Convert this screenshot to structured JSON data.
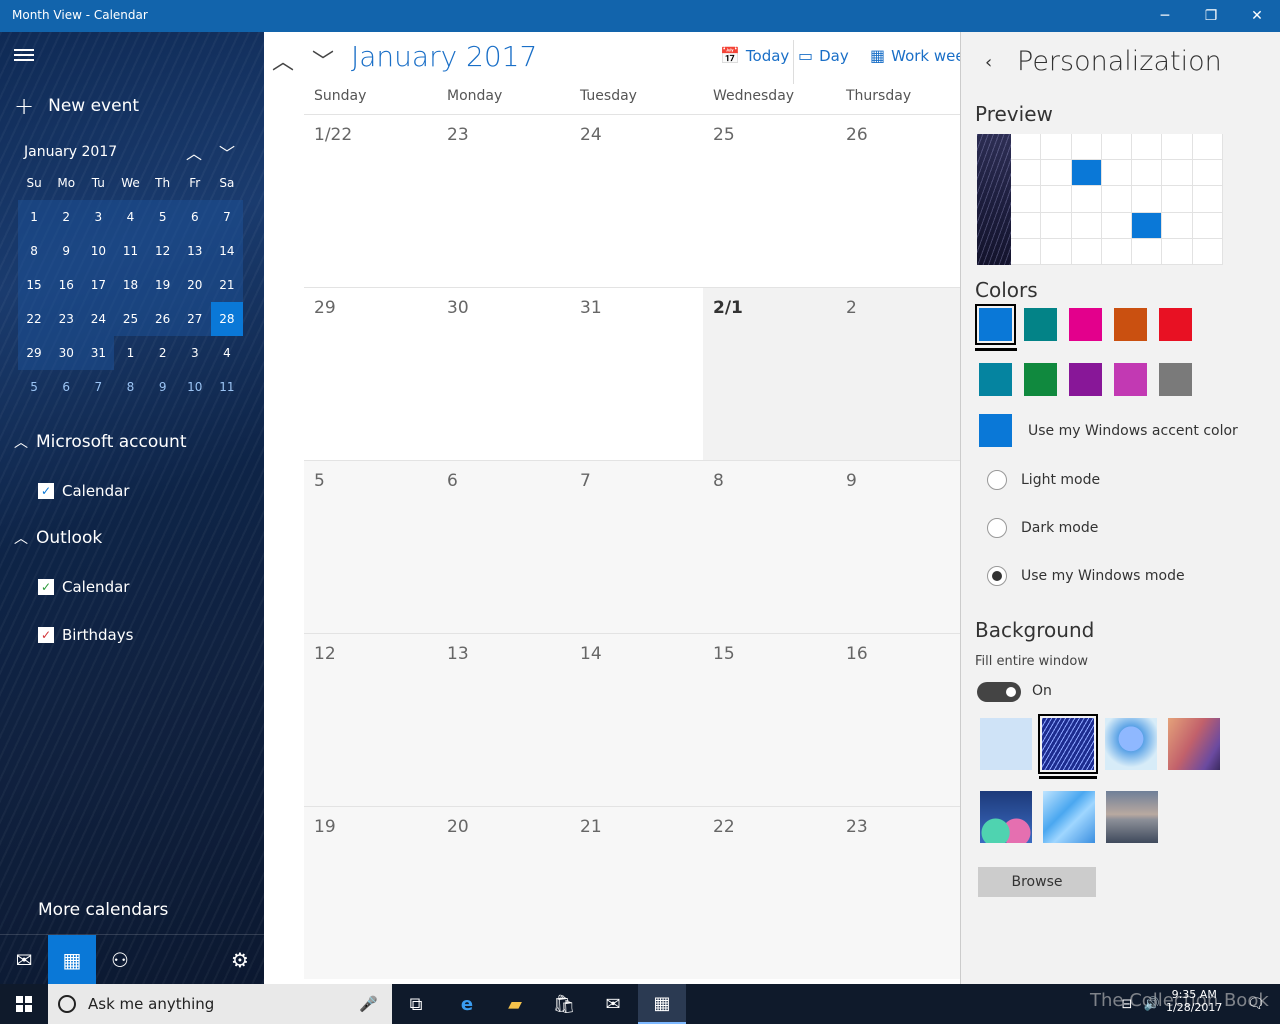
{
  "window": {
    "title": "Month View - Calendar",
    "minimize_icon": "─",
    "restore_icon": "❐",
    "close_icon": "✕"
  },
  "sidebar": {
    "new_event": "New event",
    "mini_calendar": {
      "month_label": "January 2017",
      "days_of_week": [
        "Su",
        "Mo",
        "Tu",
        "We",
        "Th",
        "Fr",
        "Sa"
      ],
      "days": [
        [
          "1",
          "2",
          "3",
          "4",
          "5",
          "6",
          "7"
        ],
        [
          "8",
          "9",
          "10",
          "11",
          "12",
          "13",
          "14"
        ],
        [
          "15",
          "16",
          "17",
          "18",
          "19",
          "20",
          "21"
        ],
        [
          "22",
          "23",
          "24",
          "25",
          "26",
          "27",
          "28"
        ],
        [
          "29",
          "30",
          "31",
          "1",
          "2",
          "3",
          "4"
        ],
        [
          "5",
          "6",
          "7",
          "8",
          "9",
          "10",
          "11"
        ]
      ],
      "selected_day": "28"
    },
    "accounts": [
      {
        "name": "Microsoft account",
        "calendars": [
          {
            "label": "Calendar",
            "color": "#0a78d7"
          }
        ]
      },
      {
        "name": "Outlook",
        "calendars": [
          {
            "label": "Calendar",
            "color": "#2b9a3a"
          },
          {
            "label": "Birthdays",
            "color": "#d13438"
          }
        ]
      }
    ],
    "more_calendars": "More calendars",
    "bottom_icons": [
      "mail-icon",
      "calendar-icon",
      "people-icon",
      "settings-icon"
    ]
  },
  "main": {
    "month_title": "January 2017",
    "toolbar": {
      "today": "Today",
      "day": "Day",
      "work_week": "Work week"
    },
    "days_of_week": [
      "Sunday",
      "Monday",
      "Tuesday",
      "Wednesday",
      "Thursday"
    ],
    "weeks": [
      [
        "1/22",
        "23",
        "24",
        "25",
        "26"
      ],
      [
        "29",
        "30",
        "31",
        "2/1",
        "2"
      ],
      [
        "5",
        "6",
        "7",
        "8",
        "9"
      ],
      [
        "12",
        "13",
        "14",
        "15",
        "16"
      ],
      [
        "19",
        "20",
        "21",
        "22",
        "23"
      ]
    ]
  },
  "personalization": {
    "title": "Personalization",
    "preview_heading": "Preview",
    "colors_heading": "Colors",
    "color_swatches": [
      "#0a78d7",
      "#038387",
      "#e3008c",
      "#ca5010",
      "#e81123",
      "#0584a0",
      "#10893e",
      "#881798",
      "#c239b3",
      "#7a7a7a"
    ],
    "selected_color": "#0a78d7",
    "accent_label": "Use my Windows accent color",
    "modes": [
      {
        "label": "Light mode",
        "selected": false
      },
      {
        "label": "Dark mode",
        "selected": false
      },
      {
        "label": "Use my Windows mode",
        "selected": true
      }
    ],
    "background_heading": "Background",
    "fill_label": "Fill entire window",
    "fill_state": "On",
    "browse_label": "Browse"
  },
  "taskbar": {
    "search_placeholder": "Ask me anything",
    "time": "9:35 AM",
    "date": "1/28/2017",
    "watermark": "The Collection Book"
  }
}
